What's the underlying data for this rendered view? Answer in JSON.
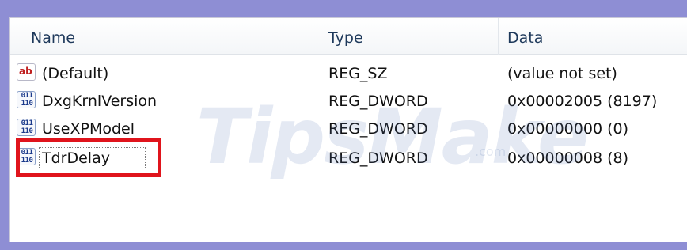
{
  "columns": {
    "name": "Name",
    "type": "Type",
    "data": "Data"
  },
  "rows": [
    {
      "icon": "string-value-icon",
      "icon_text": "ab",
      "name": "(Default)",
      "type": "REG_SZ",
      "data": "(value not set)"
    },
    {
      "icon": "binary-value-icon",
      "icon_text": "011\n110",
      "name": "DxgKrnlVersion",
      "type": "REG_DWORD",
      "data": "0x00002005 (8197)"
    },
    {
      "icon": "binary-value-icon",
      "icon_text": "011\n110",
      "name": "UseXPModel",
      "type": "REG_DWORD",
      "data": "0x00000000 (0)"
    },
    {
      "icon": "binary-value-icon",
      "icon_text": "011\n110",
      "name": "TdrDelay",
      "type": "REG_DWORD",
      "data": "0x00000008 (8)"
    }
  ],
  "selected_row": "TdrDelay",
  "highlight_color": "#e0141c",
  "watermark": {
    "text": "TipsMake",
    "suffix": ".com"
  }
}
